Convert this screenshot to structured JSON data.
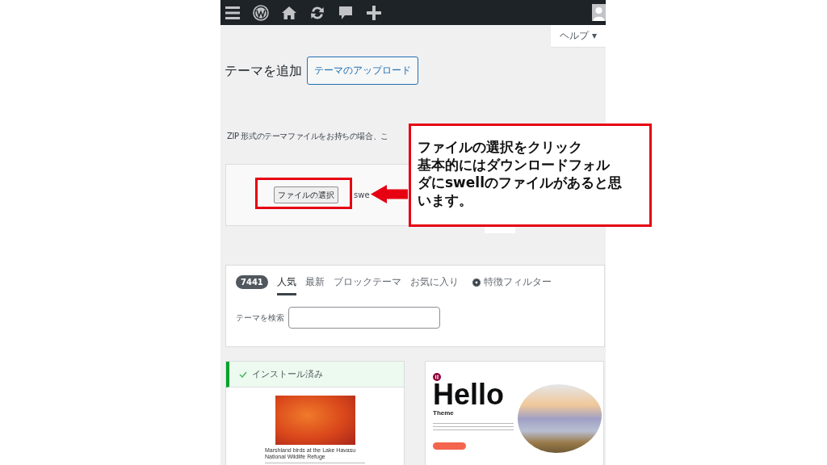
{
  "help_tab": {
    "label": "ヘルプ ▾"
  },
  "page": {
    "title": "テーマを追加",
    "upload_button": "テーマのアップロード"
  },
  "upload": {
    "description": "ZIP 形式のテーマファイルをお持ちの場合、こ",
    "file_button": "ファイルの選択",
    "file_name": "swe"
  },
  "filters": {
    "count": "7441",
    "tabs": [
      {
        "label": "人気",
        "selected": true
      },
      {
        "label": "最新",
        "selected": false
      },
      {
        "label": "ブロックテーマ",
        "selected": false
      },
      {
        "label": "お気に入り",
        "selected": false
      }
    ],
    "feature_filter": "特徴フィルター",
    "search_label": "テーマを検索"
  },
  "themes": [
    {
      "kind": "photo",
      "installed": true,
      "status": "インストール済み",
      "caption": "Marshland birds at the Lake Havasu National Wildlife Refuge"
    },
    {
      "kind": "hero",
      "installed": false,
      "heading": "Hello",
      "subheading": "Theme"
    }
  ],
  "callout": {
    "lines": [
      "ファイルの選択をクリック",
      "基本的にはダウンロードフォル",
      "ダにswellのファイルがあると思",
      "います。"
    ]
  }
}
